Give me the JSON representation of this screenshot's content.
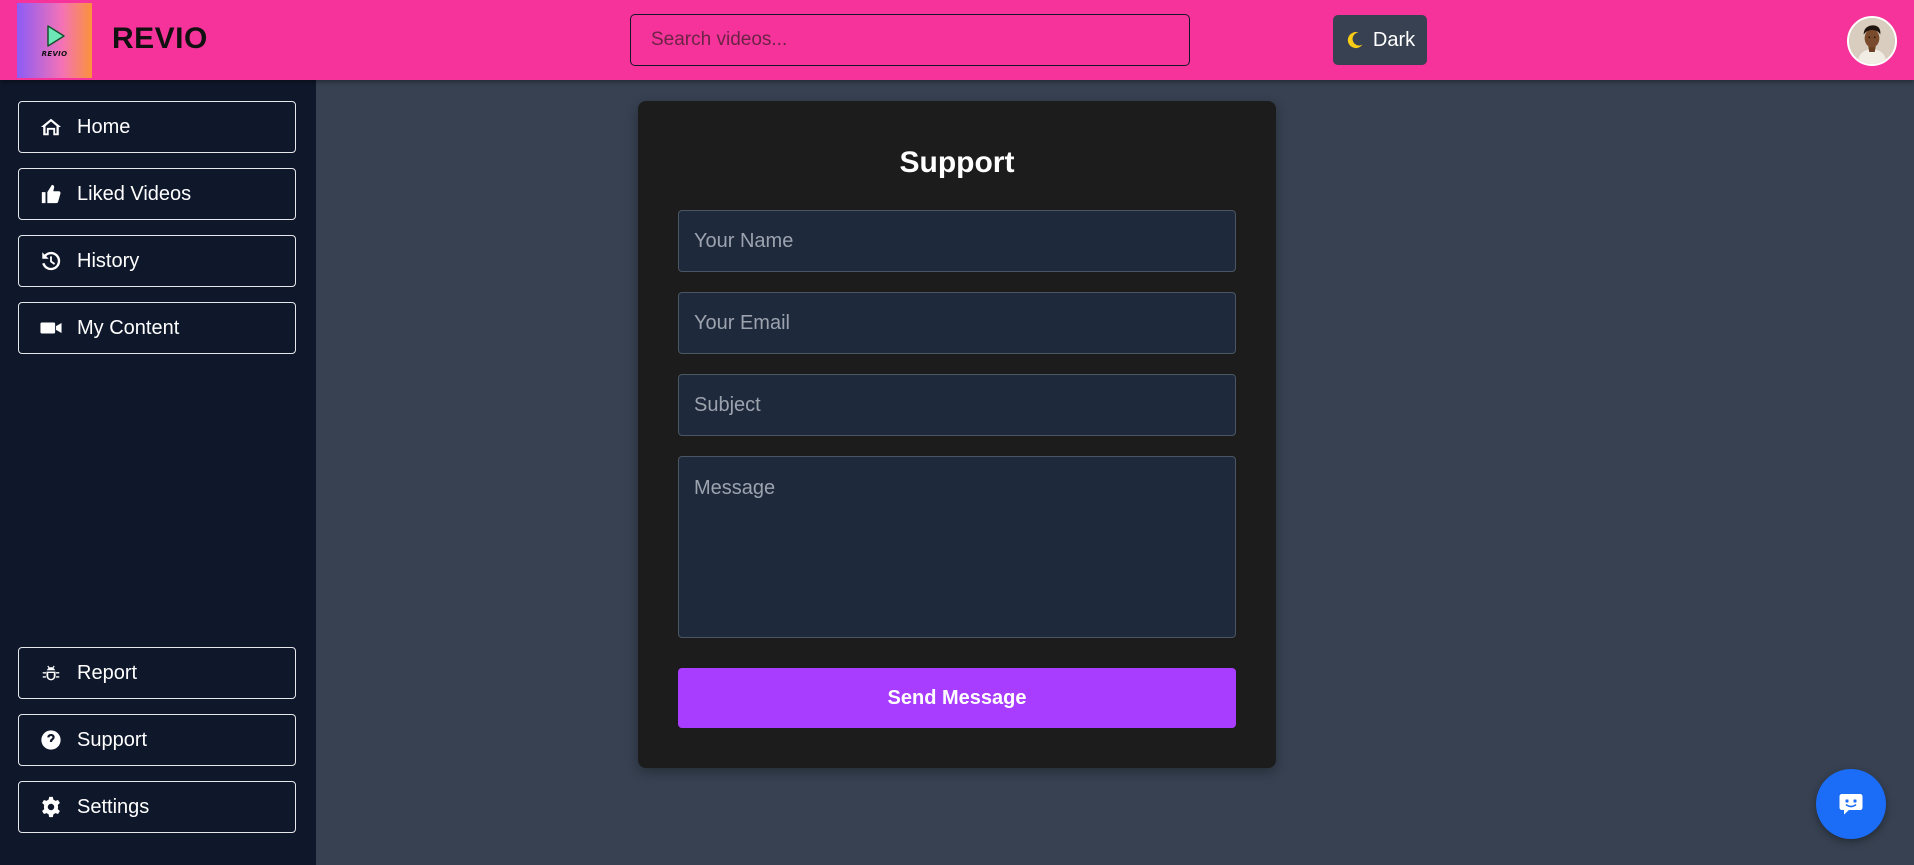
{
  "header": {
    "logo_text": "REVIO",
    "brand": "REVIO",
    "search_placeholder": "Search videos...",
    "theme_label": "Dark",
    "theme_icon": "moon-icon"
  },
  "sidebar": {
    "top_items": [
      {
        "label": "Home",
        "icon": "home-icon"
      },
      {
        "label": "Liked Videos",
        "icon": "thumbs-up-icon"
      },
      {
        "label": "History",
        "icon": "history-icon"
      },
      {
        "label": "My Content",
        "icon": "video-camera-icon"
      }
    ],
    "bottom_items": [
      {
        "label": "Report",
        "icon": "bug-icon"
      },
      {
        "label": "Support",
        "icon": "question-circle-icon"
      },
      {
        "label": "Settings",
        "icon": "gear-icon"
      }
    ]
  },
  "support_form": {
    "title": "Support",
    "name_placeholder": "Your Name",
    "email_placeholder": "Your Email",
    "subject_placeholder": "Subject",
    "message_placeholder": "Message",
    "submit_label": "Send Message"
  },
  "chat": {
    "icon": "chat-bot-icon"
  },
  "colors": {
    "header_bg": "#f6339a",
    "sidebar_bg": "#0f172a",
    "main_bg": "#374151",
    "card_bg": "#1c1c1c",
    "accent_button": "#a83cff",
    "chat_button": "#1b6cf6"
  }
}
